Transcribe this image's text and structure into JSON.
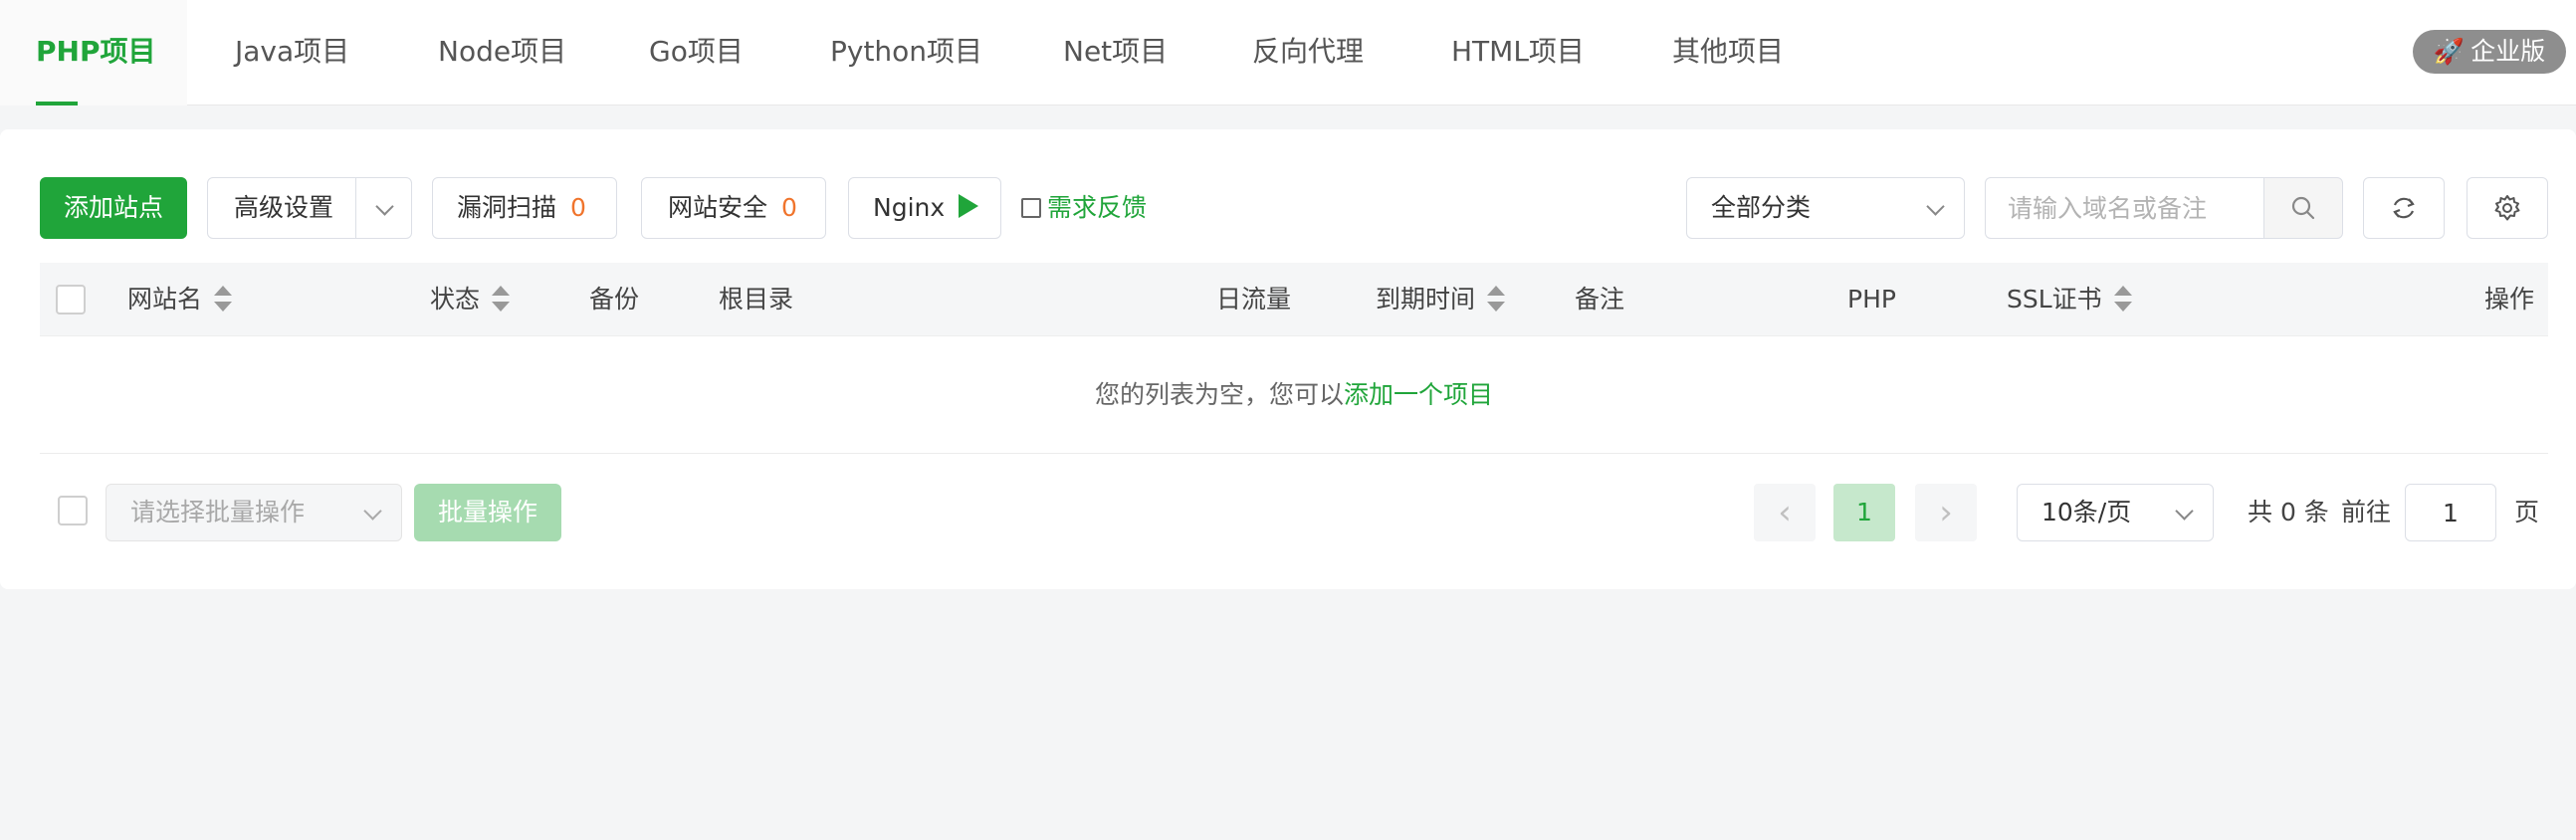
{
  "tabs": [
    {
      "label": "PHP项目",
      "active": true
    },
    {
      "label": "Java项目"
    },
    {
      "label": "Node项目"
    },
    {
      "label": "Go项目"
    },
    {
      "label": "Python项目"
    },
    {
      "label": "Net项目"
    },
    {
      "label": "反向代理"
    },
    {
      "label": "HTML项目"
    },
    {
      "label": "其他项目"
    }
  ],
  "enterprise_label": "企业版",
  "toolbar": {
    "add_site": "添加站点",
    "advanced": "高级设置",
    "vuln_scan": "漏洞扫描",
    "vuln_count": "0",
    "site_security": "网站安全",
    "security_count": "0",
    "nginx": "Nginx",
    "feedback": "需求反馈",
    "category": "全部分类",
    "search_placeholder": "请输入域名或备注"
  },
  "table": {
    "columns": [
      "网站名",
      "状态",
      "备份",
      "根目录",
      "日流量",
      "到期时间",
      "备注",
      "PHP",
      "SSL证书",
      "操作"
    ],
    "empty_text": "您的列表为空，您可以",
    "empty_link": "添加一个项目"
  },
  "footer": {
    "batch_placeholder": "请选择批量操作",
    "batch_button": "批量操作",
    "current_page": "1",
    "prev": "‹",
    "next": "›",
    "page_size": "10条/页",
    "total": "共 0 条",
    "goto": "前往",
    "goto_value": "1",
    "page_unit": "页"
  },
  "colors": {
    "accent": "#20a53a",
    "count": "#f0742c"
  }
}
